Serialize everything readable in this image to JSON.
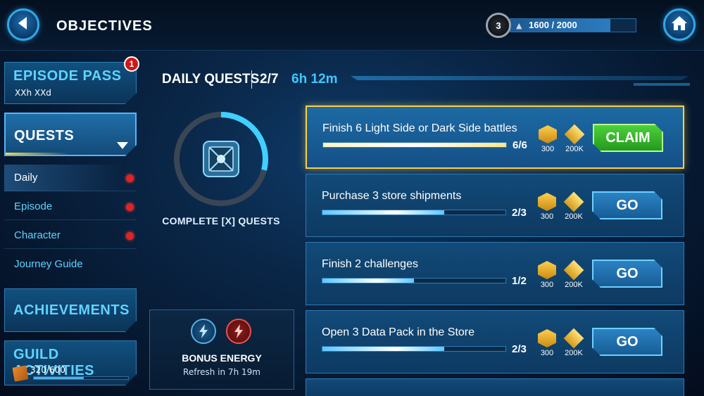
{
  "header": {
    "title": "OBJECTIVES",
    "level": "3",
    "xp_text": "1600 / 2000",
    "xp_progress": 0.8
  },
  "sidebar": {
    "episode_pass": {
      "label": "EPISODE PASS",
      "timer": "XXh XXd",
      "badge": "1"
    },
    "quests": {
      "label": "QUESTS"
    },
    "sub_items": [
      {
        "label": "Daily",
        "dot": true,
        "active": true
      },
      {
        "label": "Episode",
        "dot": true,
        "active": false
      },
      {
        "label": "Character",
        "dot": true,
        "active": false
      },
      {
        "label": "Journey Guide",
        "dot": false,
        "active": false
      }
    ],
    "achievements": {
      "label": "ACHIEVEMENTS"
    },
    "guild": {
      "label": "GUILD ACTIVITIES",
      "value": "320/600",
      "progress": 0.53
    }
  },
  "daily": {
    "title": "DAILY QUESTS",
    "count": "2/7",
    "timer": "6h 12m",
    "ring_label": "COMPLETE [X] QUESTS",
    "ring_progress": 0.29
  },
  "bonus": {
    "title": "BONUS ENERGY",
    "refresh": "Refresh in 7h 19m"
  },
  "quests": [
    {
      "title": "Finish 6 Light Side or Dark Side battles",
      "progress_text": "6/6",
      "progress": 1.0,
      "reward1": "300",
      "reward2": "200K",
      "button": "CLAIM",
      "state": "claim"
    },
    {
      "title": "Purchase 3 store shipments",
      "progress_text": "2/3",
      "progress": 0.667,
      "reward1": "300",
      "reward2": "200K",
      "button": "GO",
      "state": "go"
    },
    {
      "title": "Finish 2 challenges",
      "progress_text": "1/2",
      "progress": 0.5,
      "reward1": "300",
      "reward2": "200K",
      "button": "GO",
      "state": "go"
    },
    {
      "title": "Open 3 Data Pack in the Store",
      "progress_text": "2/3",
      "progress": 0.667,
      "reward1": "300",
      "reward2": "200K",
      "button": "GO",
      "state": "go"
    }
  ],
  "colors": {
    "accent": "#3fc7ff",
    "claim_green": "#3fbf2f",
    "highlight_gold": "#f6d04b",
    "alert_red": "#e02323"
  }
}
